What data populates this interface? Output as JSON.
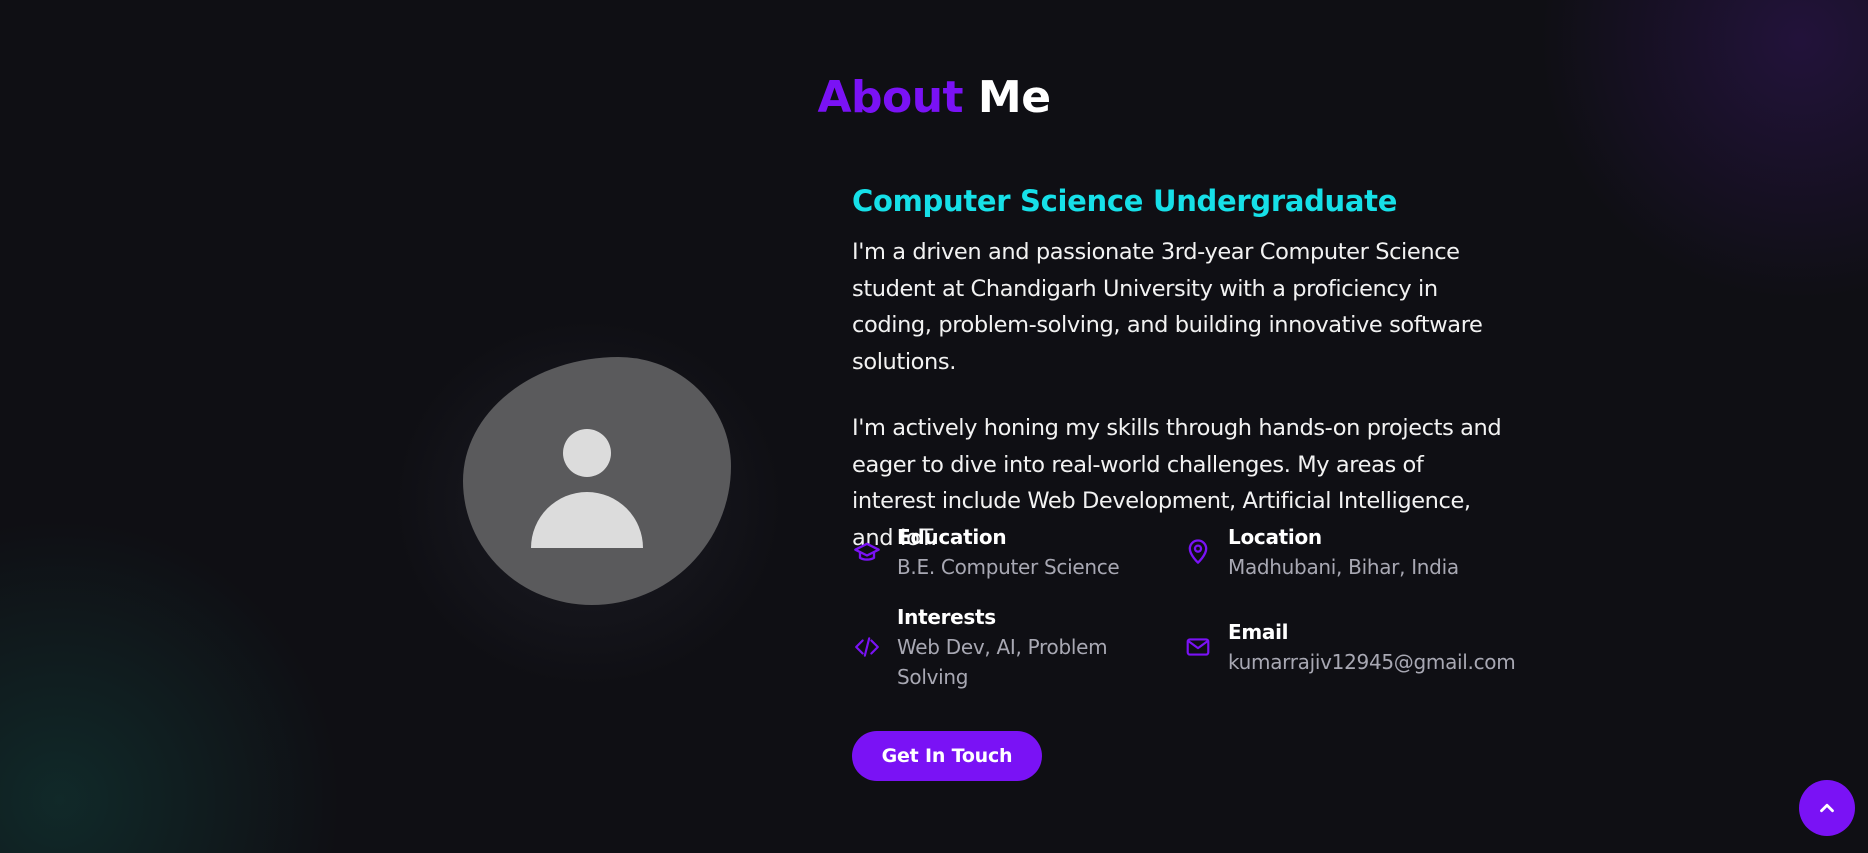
{
  "section": {
    "title_accent": "About",
    "title_rest": "Me"
  },
  "about": {
    "subtitle": "Computer Science Undergraduate",
    "paragraph_1": "I'm a driven and passionate 3rd-year Computer Science student at Chandigarh University with a proficiency in coding, problem-solving, and building innovative software solutions.",
    "paragraph_2": "I'm actively honing my skills through hands-on projects and eager to dive into real-world challenges. My areas of interest include Web Development, Artificial Intelligence, and IoT."
  },
  "info": {
    "education": {
      "label": "Education",
      "value": "B.E. Computer Science",
      "icon": "graduation-cap-icon"
    },
    "location": {
      "label": "Location",
      "value": "Madhubani, Bihar, India",
      "icon": "map-pin-icon"
    },
    "interests": {
      "label": "Interests",
      "value": "Web Dev, AI, Problem Solving",
      "icon": "code-icon"
    },
    "email": {
      "label": "Email",
      "value": "kumarrajiv12945@gmail.com",
      "icon": "mail-icon"
    }
  },
  "cta": {
    "label": "Get In Touch"
  },
  "scroll_top": {
    "icon": "chevron-up-icon"
  },
  "colors": {
    "accent": "#7a12f5",
    "subtitle": "#16e0e8",
    "background": "#0f0f14",
    "muted_text": "#a8a8b3"
  }
}
